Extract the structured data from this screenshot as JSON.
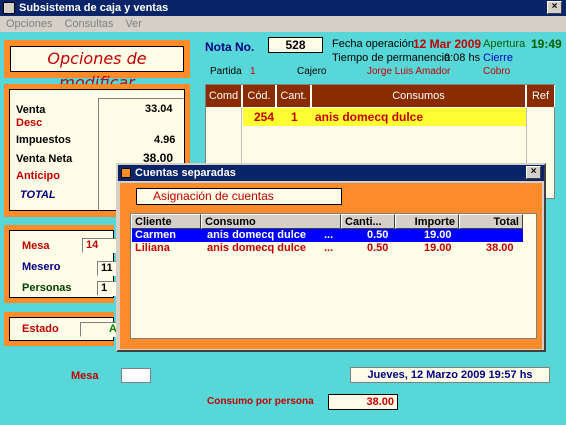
{
  "window": {
    "title": "Subsistema de caja y ventas",
    "close": "×"
  },
  "menu": [
    "Opciones",
    "Consultas",
    "Ver"
  ],
  "header_title": "Opciones de modificar",
  "nota": {
    "label": "Nota No.",
    "value": "528"
  },
  "fecha": {
    "label": "Fecha operación",
    "value": "12 Mar 2009"
  },
  "apertura": {
    "label": "Apertura",
    "value": "19:49"
  },
  "permanencia": {
    "label": "Tiempo de permanencia",
    "value": "0:08 hs"
  },
  "cierre": {
    "label": "Cierre"
  },
  "partida": {
    "label": "Partida",
    "value": "1"
  },
  "cajero": {
    "label": "Cajero",
    "value": "Jorge Luis Amador"
  },
  "cobro": {
    "label": "Cobro"
  },
  "totals": {
    "venta": {
      "label": "Venta",
      "value": "33.04"
    },
    "desc": {
      "label": "Desc"
    },
    "impuestos": {
      "label": "Impuestos",
      "value": "4.96"
    },
    "venta_neta": {
      "label": "Venta Neta",
      "value": "38.00"
    },
    "anticipo": {
      "label": "Anticipo"
    },
    "total": {
      "label": "TOTAL"
    }
  },
  "mesa": {
    "label": "Mesa",
    "value": "14"
  },
  "mesero": {
    "label": "Mesero",
    "value": "11"
  },
  "personas": {
    "label": "Personas",
    "value": "1"
  },
  "estado": {
    "label": "Estado",
    "value": "Ab"
  },
  "bottom_mesa": {
    "label": "Mesa"
  },
  "bottom_date": "Jueves, 12 Marzo 2009   19:57 hs",
  "consumo_persona": {
    "label": "Consumo por persona",
    "value": "38.00"
  },
  "grid": {
    "headers": [
      "Comd",
      "Cód.",
      "Cant.",
      "Consumos",
      "Ref"
    ],
    "row": {
      "cod": "254",
      "cant": "1",
      "consumo": "anis domecq dulce"
    }
  },
  "child": {
    "title": "Cuentas separadas",
    "close": "×",
    "heading": "Asignación de cuentas",
    "headers": [
      "Cliente",
      "Consumo",
      "Canti...",
      "Importe",
      "Total"
    ],
    "rows": [
      {
        "cliente": "Carmen",
        "consumo": "anis domecq dulce",
        "dots": "...",
        "cant": "0.50",
        "importe": "19.00",
        "total": ""
      },
      {
        "cliente": "Liliana",
        "consumo": "anis domecq dulce",
        "dots": "...",
        "cant": "0.50",
        "importe": "19.00",
        "total": "38.00"
      }
    ]
  },
  "colors": {
    "teal": "#57d7d7",
    "orange": "#ff8c28",
    "cream": "#fffde7",
    "grid_header": "#8a2b00",
    "selection": "#0000ff",
    "highlight": "#ffff33"
  }
}
